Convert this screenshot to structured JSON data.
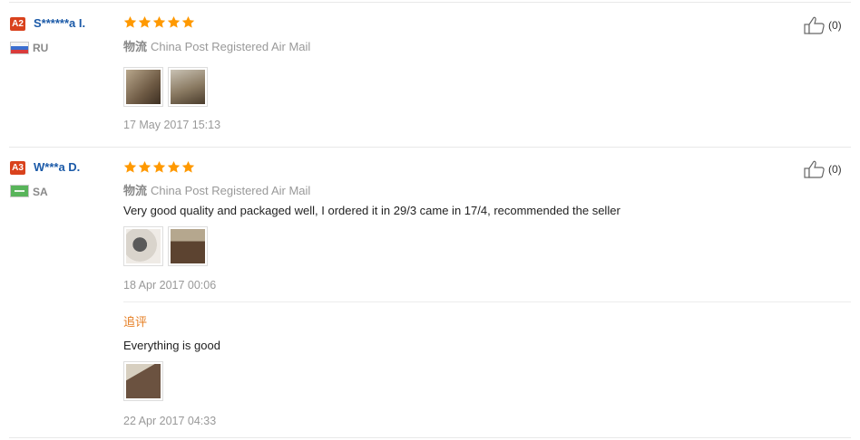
{
  "colors": {
    "accent": "#ff9900",
    "username": "#1b5aa8",
    "badge": "#d9421d",
    "followup": "#e67e22"
  },
  "reviews": [
    {
      "badge": "A2",
      "user": "S******a I.",
      "country": "RU",
      "flag_icon": "russia-flag-icon",
      "rating": 5,
      "logistics_label": "物流",
      "logistics": "China Post Registered Air Mail",
      "text": "",
      "photos": [
        "photo-thumbnail-1",
        "photo-thumbnail-2"
      ],
      "date": "17 May 2017 15:13",
      "likes": "(0)"
    },
    {
      "badge": "A3",
      "user": "W***a D.",
      "country": "SA",
      "flag_icon": "saudi-arabia-flag-icon",
      "rating": 5,
      "logistics_label": "物流",
      "logistics": "China Post Registered Air Mail",
      "text": "Very good quality and packaged well, I ordered it in 29/3 came in 17/4, recommended the seller",
      "photos": [
        "photo-thumbnail-1",
        "photo-thumbnail-2"
      ],
      "date": "18 Apr 2017 00:06",
      "likes": "(0)",
      "followup": {
        "label": "追评",
        "text": "Everything is good",
        "photos": [
          "photo-thumbnail-1"
        ],
        "date": "22 Apr 2017 04:33"
      }
    }
  ]
}
